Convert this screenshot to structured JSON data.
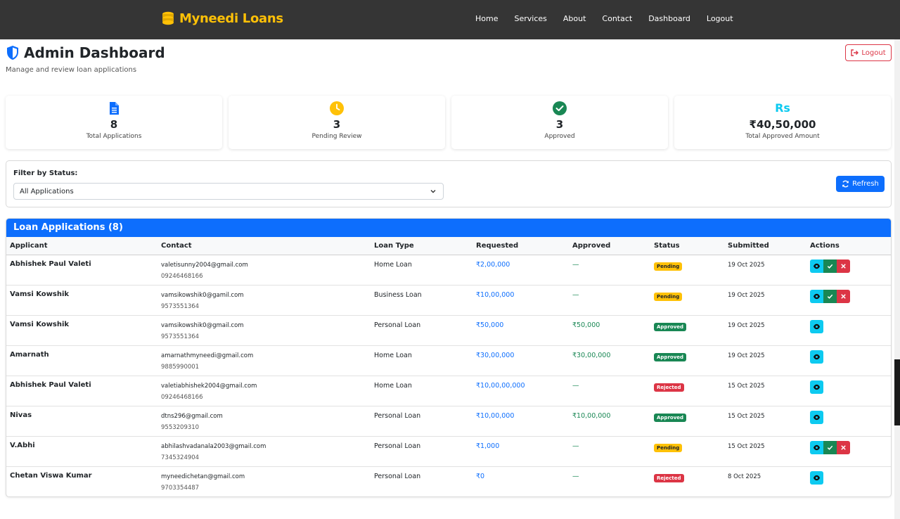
{
  "nav": {
    "brand": "Myneedi Loans",
    "links": [
      "Home",
      "Services",
      "About",
      "Contact",
      "Dashboard",
      "Logout"
    ]
  },
  "header": {
    "title": "Admin Dashboard",
    "subtitle": "Manage and review loan applications",
    "logout_label": "Logout"
  },
  "stats": [
    {
      "value": "8",
      "label": "Total Applications",
      "icon": "document-icon",
      "color": "#0d6efd"
    },
    {
      "value": "3",
      "label": "Pending Review",
      "icon": "clock-icon",
      "color": "#ffc107"
    },
    {
      "value": "3",
      "label": "Approved",
      "icon": "check-circle-icon",
      "color": "#198754"
    },
    {
      "value": "₹40,50,000",
      "label": "Total Approved Amount",
      "icon": "rupee-icon",
      "icon_text": "Rs",
      "color": "#0dcaf0"
    }
  ],
  "filter": {
    "label": "Filter by Status:",
    "selected": "All Applications",
    "refresh_label": "Refresh"
  },
  "table": {
    "title": "Loan Applications (8)",
    "columns": [
      "Applicant",
      "Contact",
      "Loan Type",
      "Requested",
      "Approved",
      "Status",
      "Submitted",
      "Actions"
    ],
    "rows": [
      {
        "name": "Abhishek Paul Valeti",
        "email": "valetisunny2004@gmail.com",
        "phone": "09246468166",
        "loan_type": "Home Loan",
        "requested": "₹2,00,000",
        "approved": "—",
        "status": "Pending",
        "submitted": "19 Oct 2025"
      },
      {
        "name": "Vamsi Kowshik",
        "email": "vamsikowshik0@gamil.com",
        "phone": "9573551364",
        "loan_type": "Business Loan",
        "requested": "₹10,00,000",
        "approved": "—",
        "status": "Pending",
        "submitted": "19 Oct 2025"
      },
      {
        "name": "Vamsi Kowshik",
        "email": "vamsikowshik0@gmail.com",
        "phone": "9573551364",
        "loan_type": "Personal Loan",
        "requested": "₹50,000",
        "approved": "₹50,000",
        "status": "Approved",
        "submitted": "19 Oct 2025"
      },
      {
        "name": "Amarnath",
        "email": "amarnathmyneedi@gmail.com",
        "phone": "9885990001",
        "loan_type": "Home Loan",
        "requested": "₹30,00,000",
        "approved": "₹30,00,000",
        "status": "Approved",
        "submitted": "19 Oct 2025"
      },
      {
        "name": "Abhishek Paul Valeti",
        "email": "valetiabhishek2004@gmail.com",
        "phone": "09246468166",
        "loan_type": "Home Loan",
        "requested": "₹10,00,00,000",
        "approved": "—",
        "status": "Rejected",
        "submitted": "15 Oct 2025"
      },
      {
        "name": "Nivas",
        "email": "dtns296@gmail.com",
        "phone": "9553209310",
        "loan_type": "Personal Loan",
        "requested": "₹10,00,000",
        "approved": "₹10,00,000",
        "status": "Approved",
        "submitted": "15 Oct 2025"
      },
      {
        "name": "V.Abhi",
        "email": "abhilashvadanala2003@gmail.com",
        "phone": "7345324904",
        "loan_type": "Personal Loan",
        "requested": "₹1,000",
        "approved": "—",
        "status": "Pending",
        "submitted": "15 Oct 2025"
      },
      {
        "name": "Chetan Viswa Kumar",
        "email": "myneedichetan@gmail.com",
        "phone": "9703354487",
        "loan_type": "Personal Loan",
        "requested": "₹0",
        "approved": "—",
        "status": "Rejected",
        "submitted": "8 Oct 2025"
      }
    ]
  },
  "colors": {
    "navbar": "#353535",
    "brand": "#ffc107",
    "primary": "#0d6efd",
    "success": "#198754",
    "danger": "#dc3545",
    "warning": "#ffc107",
    "info": "#0dcaf0"
  }
}
